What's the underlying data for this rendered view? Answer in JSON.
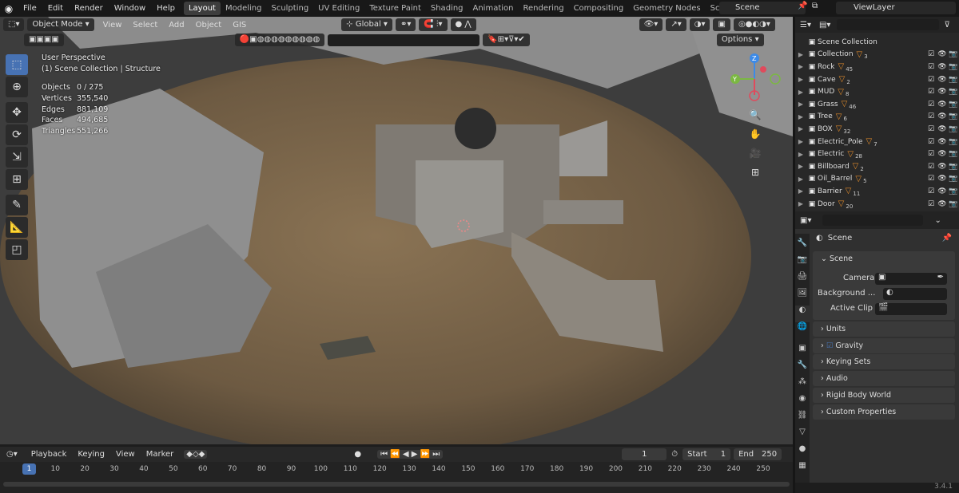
{
  "topbar": {
    "menus": [
      "File",
      "Edit",
      "Render",
      "Window",
      "Help"
    ],
    "workspaces": [
      "Layout",
      "Modeling",
      "Sculpting",
      "UV Editing",
      "Texture Paint",
      "Shading",
      "Animation",
      "Rendering",
      "Compositing",
      "Geometry Nodes",
      "Scripting"
    ],
    "active_workspace": "Layout",
    "add_tab": "+",
    "scene": "Scene",
    "view_layer": "ViewLayer"
  },
  "viewport": {
    "mode": "Object Mode",
    "menus": [
      "View",
      "Select",
      "Add",
      "Object",
      "GIS"
    ],
    "orientation": "Global",
    "options": "Options",
    "perspective": "User Perspective",
    "collection": "(1) Scene Collection | Structure",
    "stats": [
      {
        "k": "Objects",
        "v": "0 / 275"
      },
      {
        "k": "Vertices",
        "v": "355,540"
      },
      {
        "k": "Edges",
        "v": "881,109"
      },
      {
        "k": "Faces",
        "v": "494,685"
      },
      {
        "k": "Triangles",
        "v": "551,266"
      }
    ],
    "gizmo": {
      "x": "X",
      "y": "Y",
      "z": "Z"
    }
  },
  "outliner": {
    "root": "Scene Collection",
    "items": [
      {
        "name": "Collection",
        "count": "3"
      },
      {
        "name": "Rock",
        "count": "45"
      },
      {
        "name": "Cave",
        "count": "2"
      },
      {
        "name": "MUD",
        "count": "8"
      },
      {
        "name": "Grass",
        "count": "46"
      },
      {
        "name": "Tree",
        "count": "6"
      },
      {
        "name": "BOX",
        "count": "32"
      },
      {
        "name": "Electric_Pole",
        "count": "7"
      },
      {
        "name": "Electric",
        "count": "28"
      },
      {
        "name": "Billboard",
        "count": "2"
      },
      {
        "name": "Oil_Barrel",
        "count": "5"
      },
      {
        "name": "Barrier",
        "count": "11"
      },
      {
        "name": "Door",
        "count": "20"
      }
    ]
  },
  "properties": {
    "title": "Scene",
    "section": "Scene",
    "camera_label": "Camera",
    "background_label": "Background ...",
    "active_clip_label": "Active Clip",
    "subpanels": [
      "Units",
      "Gravity",
      "Keying Sets",
      "Audio",
      "Rigid Body World",
      "Custom Properties"
    ],
    "gravity_checked": true
  },
  "timeline": {
    "menus": [
      "Playback",
      "Keying",
      "View",
      "Marker"
    ],
    "current_frame": "1",
    "start_label": "Start",
    "start": "1",
    "end_label": "End",
    "end": "250",
    "ticks": [
      "1",
      "10",
      "20",
      "30",
      "40",
      "50",
      "60",
      "70",
      "80",
      "90",
      "100",
      "110",
      "120",
      "130",
      "140",
      "150",
      "160",
      "170",
      "180",
      "190",
      "200",
      "210",
      "220",
      "230",
      "240",
      "250"
    ]
  },
  "status": {
    "version": "3.4.1"
  }
}
